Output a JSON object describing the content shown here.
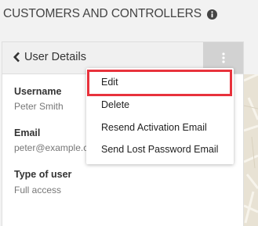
{
  "page": {
    "title": "CUSTOMERS AND CONTROLLERS",
    "icon": "info-icon"
  },
  "panel": {
    "back_label": "User Details",
    "back_icon": "chevron-left-icon",
    "menu_icon": "kebab-menu-icon"
  },
  "fields": [
    {
      "label": "Username",
      "value": "Peter Smith"
    },
    {
      "label": "Email",
      "value": "peter@example.com"
    },
    {
      "label": "Type of user",
      "value": "Full access"
    }
  ],
  "menu": {
    "items": [
      {
        "label": "Edit",
        "highlighted": true
      },
      {
        "label": "Delete"
      },
      {
        "label": "Resend Activation Email"
      },
      {
        "label": "Send Lost Password Email"
      }
    ]
  },
  "colors": {
    "highlight": "#e8323c",
    "header_bg": "#f0f0f0",
    "kebab_bg": "#d2d2d2",
    "page_bg": "#f2f2f2"
  }
}
